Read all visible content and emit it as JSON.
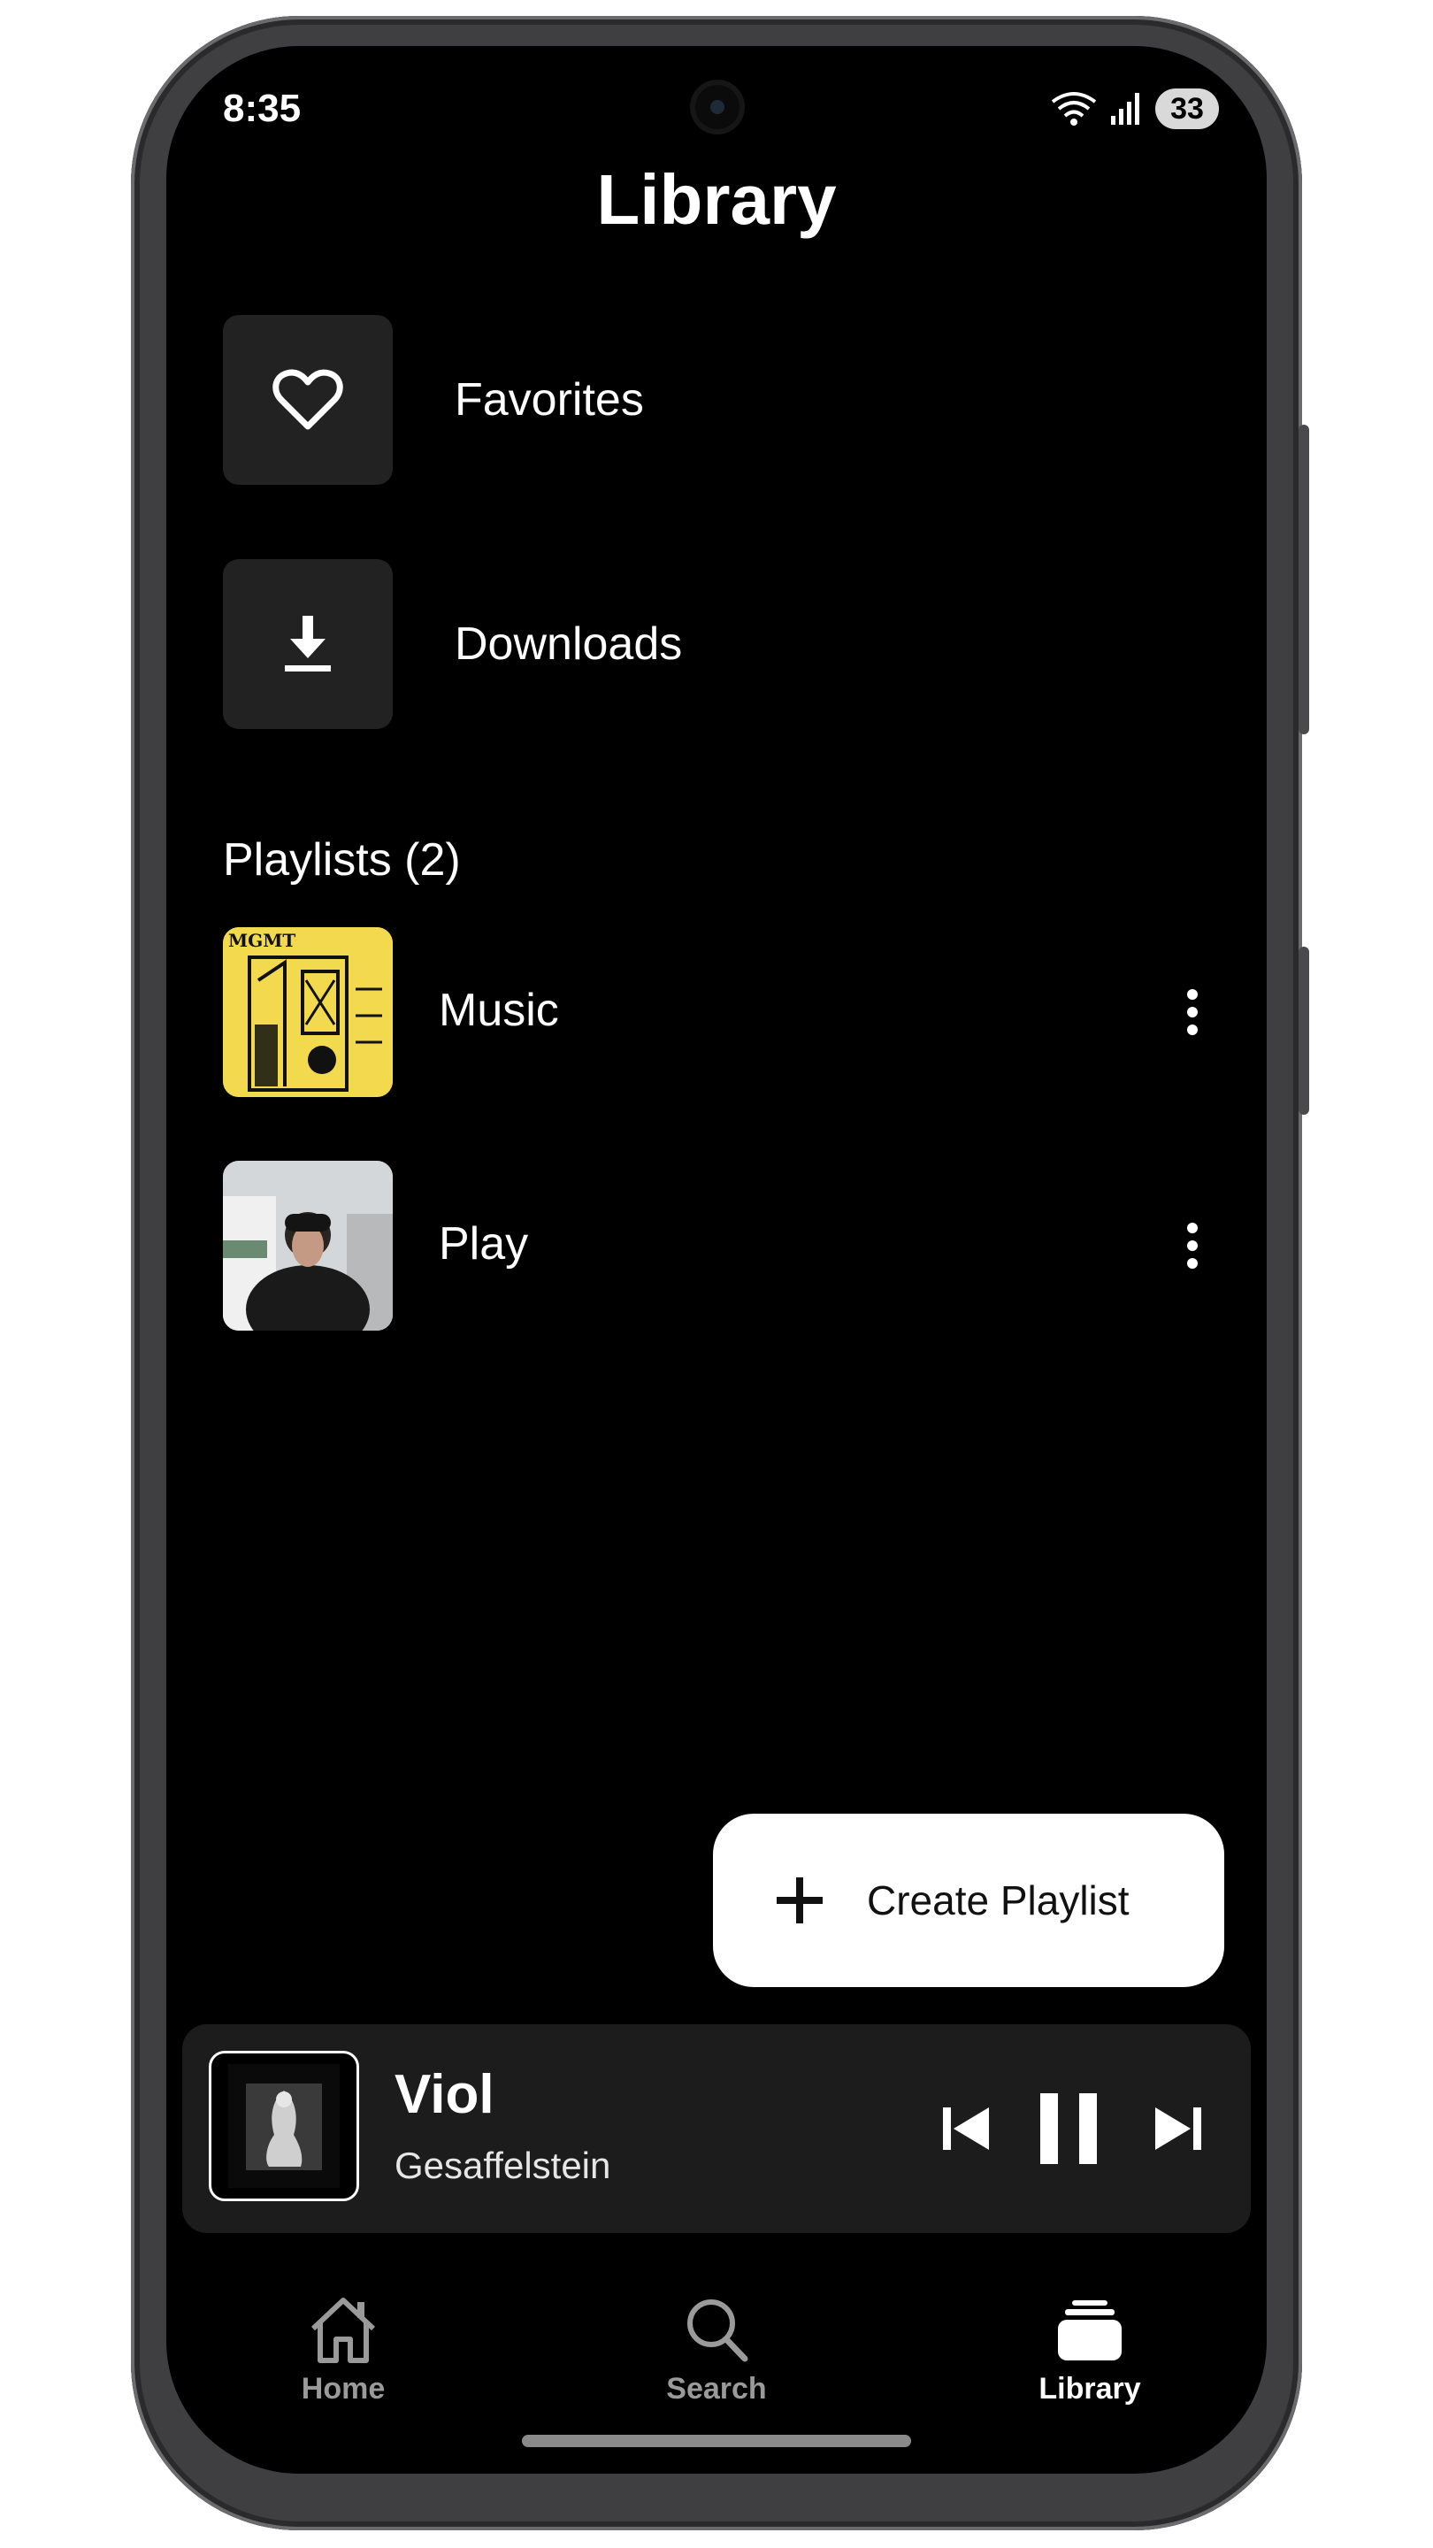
{
  "status": {
    "time": "8:35",
    "battery": "33"
  },
  "header": {
    "title": "Library"
  },
  "quick_items": [
    {
      "label": "Favorites",
      "icon": "heart-icon"
    },
    {
      "label": "Downloads",
      "icon": "download-icon"
    }
  ],
  "playlists": {
    "title": "Playlists (2)",
    "items": [
      {
        "name": "Music",
        "cover": "yellow-album-art"
      },
      {
        "name": "Play",
        "cover": "photo-album-art"
      }
    ]
  },
  "fab": {
    "label": "Create Playlist",
    "icon": "plus-icon"
  },
  "now_playing": {
    "title": "Viol",
    "artist": "Gesaffelstein",
    "is_playing": true
  },
  "bottom_nav": {
    "items": [
      {
        "label": "Home",
        "icon": "home-icon",
        "active": false
      },
      {
        "label": "Search",
        "icon": "search-icon",
        "active": false
      },
      {
        "label": "Library",
        "icon": "library-icon",
        "active": true
      }
    ]
  },
  "colors": {
    "background": "#000000",
    "surface": "#222222",
    "accent": "#ffffff",
    "inactive": "#9a9a9a"
  }
}
